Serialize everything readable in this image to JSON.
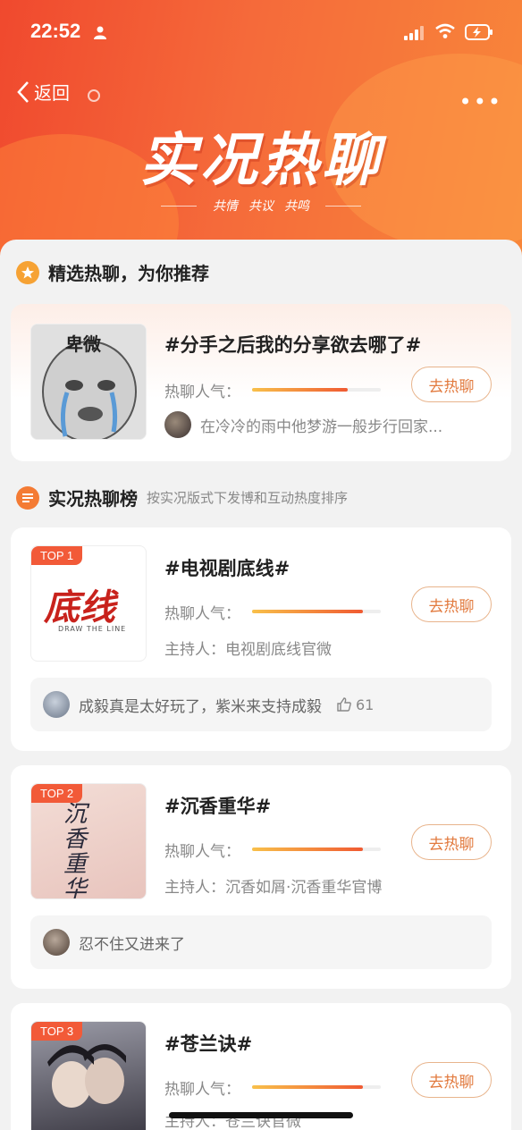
{
  "status_bar": {
    "time": "22:52"
  },
  "nav": {
    "back_label": "返回"
  },
  "banner": {
    "title": "实况热聊",
    "subtitle_words": [
      "共情",
      "共议",
      "共鸣"
    ]
  },
  "featured": {
    "section_title": "精选热聊，为你推荐",
    "card": {
      "thumb_text": "卑微",
      "title": "#分手之后我的分享欲去哪了#",
      "heat_label": "热聊人气：",
      "heat_level": 0.74,
      "button": "去热聊",
      "comment": "在冷冷的雨中他梦游一般步行回家..."
    }
  },
  "ranking": {
    "section_title": "实况热聊榜",
    "section_note": "按实况版式下发博和互动热度排序",
    "items": [
      {
        "rank": "TOP 1",
        "thumb_title": "底线",
        "thumb_sub": "DRAW THE LINE",
        "title": "#电视剧底线#",
        "heat_label": "热聊人气：",
        "heat_level": 0.86,
        "button": "去热聊",
        "host": "主持人：电视剧底线官微",
        "comment": "成毅真是太好玩了，紫米来支持成毅",
        "likes": "61"
      },
      {
        "rank": "TOP 2",
        "thumb_title": "沉香重华",
        "title": "#沉香重华#",
        "heat_label": "热聊人气：",
        "heat_level": 0.86,
        "button": "去热聊",
        "host": "主持人：沉香如屑·沉香重华官博",
        "comment": "忍不住又进来了"
      },
      {
        "rank": "TOP 3",
        "title": "#苍兰诀#",
        "heat_label": "热聊人气：",
        "heat_level": 0.86,
        "button": "去热聊",
        "host": "主持人：苍兰诀官微"
      }
    ]
  },
  "colors": {
    "accent": "#f25a38",
    "button_text": "#e27a3e",
    "heat_start": "#f8c04a",
    "heat_end": "#f05a32"
  }
}
